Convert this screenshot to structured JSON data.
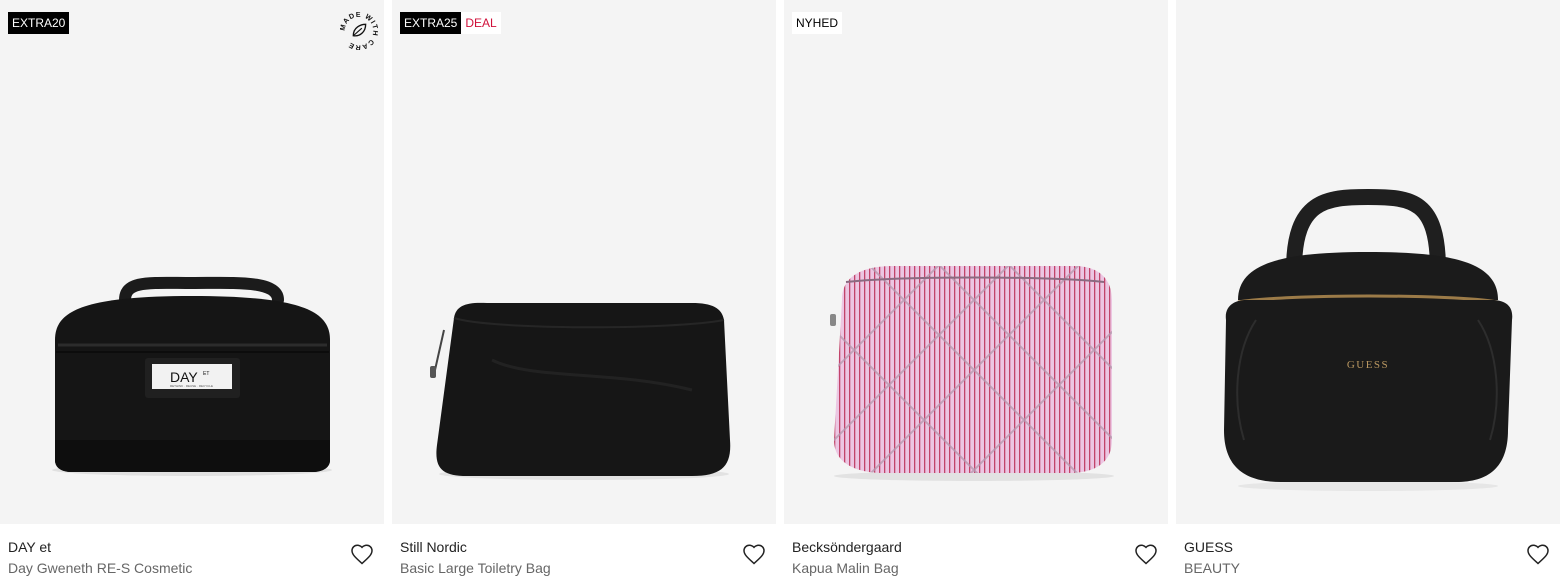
{
  "products": [
    {
      "badges": [
        {
          "text": "EXTRA20",
          "style": "dark"
        }
      ],
      "brand": "DAY et",
      "name": "Day Gweneth RE-S Cosmetic",
      "made_with_care": "MADE WITH CARE",
      "bag_logo": "DAY",
      "bag_logo_sup": "ET",
      "bag_logo_sub": "RETHINK · REUSE · RECYCLE",
      "bag_color": "#151515"
    },
    {
      "badges": [
        {
          "text": "EXTRA25",
          "style": "dark"
        },
        {
          "text": "DEAL",
          "style": "deal"
        }
      ],
      "brand": "Still Nordic",
      "name": "Basic Large Toiletry Bag",
      "bag_color": "#161616"
    },
    {
      "badges": [
        {
          "text": "NYHED",
          "style": "light"
        }
      ],
      "brand": "Becksöndergaard",
      "name": "Kapua Malin Bag",
      "bag_color": "#e8bfdc"
    },
    {
      "badges": [],
      "brand": "GUESS",
      "name": "BEAUTY",
      "bag_logo": "GUESS",
      "bag_color": "#1a1a1a"
    }
  ],
  "colors": {
    "tile_bg": "#f4f4f4",
    "badge_dark": "#000000",
    "deal_red": "#d0103a"
  },
  "icons": {
    "favorite": "heart-outline-icon",
    "sustainability": "made-with-care-leaf-icon"
  }
}
